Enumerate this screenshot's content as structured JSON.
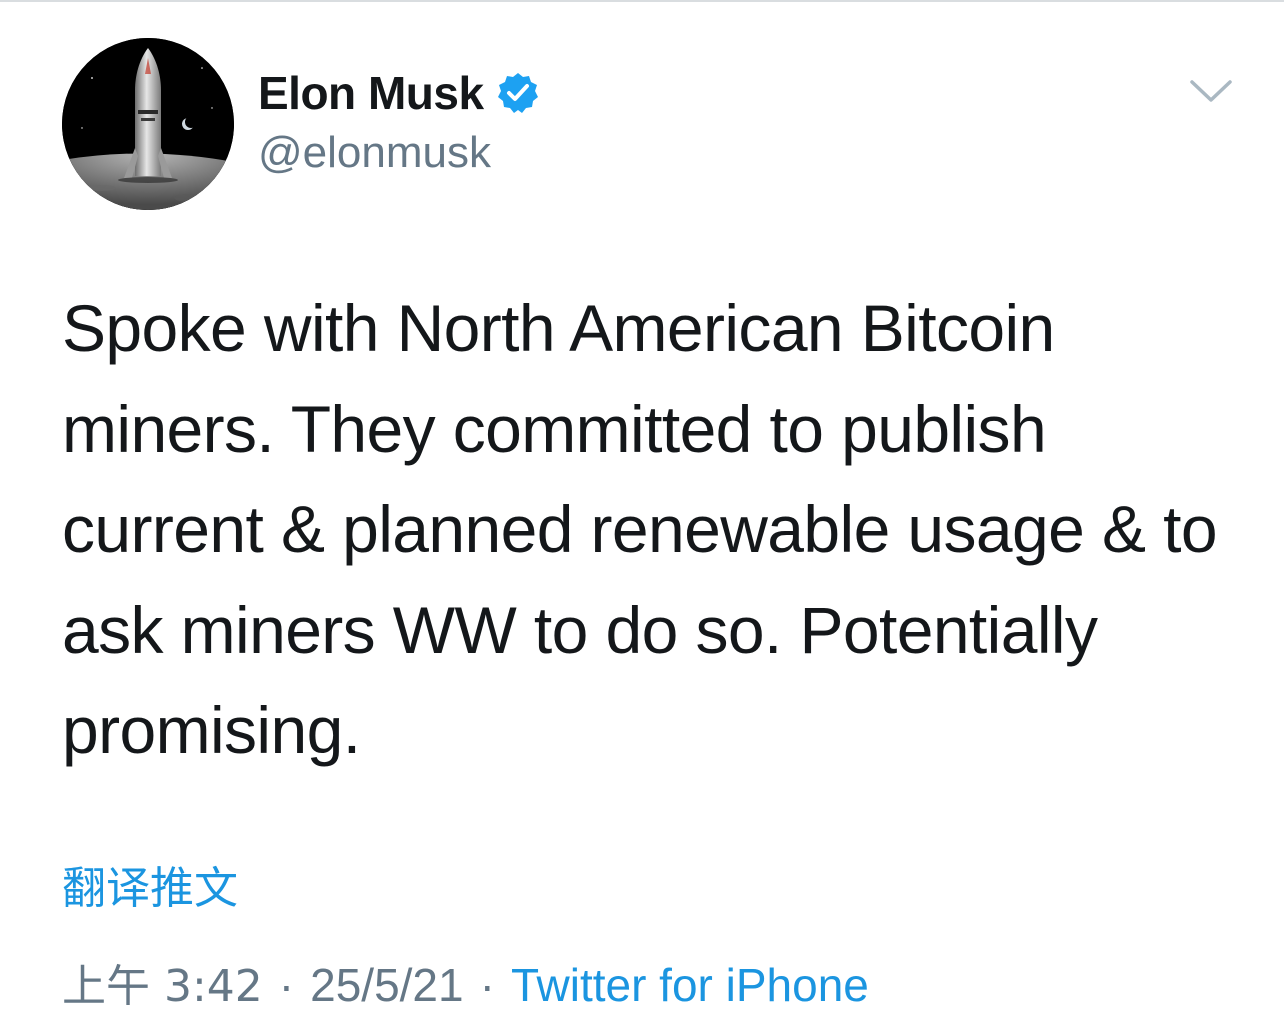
{
  "author": {
    "display_name": "Elon Musk",
    "handle": "@elonmusk",
    "verified": true
  },
  "tweet": {
    "text": "Spoke with North American Bitcoin miners. They committed to publish current & planned renewable usage & to ask miners WW to do so. Potentially promising.",
    "translate_label": "翻译推文",
    "time": "上午 3:42",
    "date": "25/5/21",
    "separator": "·",
    "source": "Twitter for iPhone"
  },
  "icons": {
    "verified": "verified-badge-icon",
    "menu": "chevron-down-icon"
  },
  "colors": {
    "link": "#1b95e0",
    "secondary_text": "#657786",
    "primary_text": "#14171a",
    "verified_badge": "#1da1f2"
  }
}
